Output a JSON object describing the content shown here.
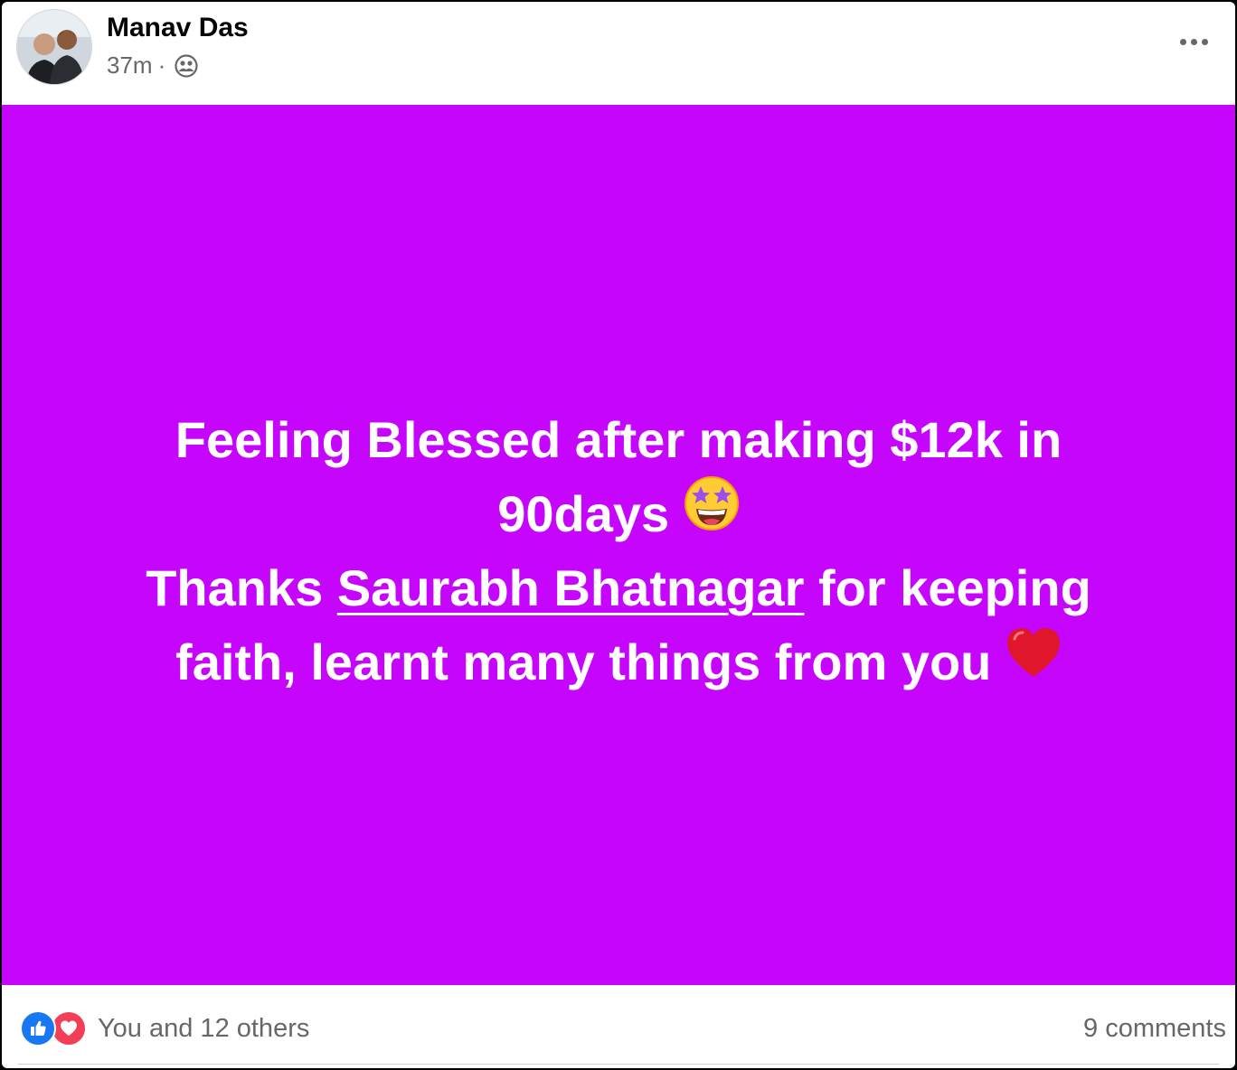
{
  "post": {
    "author": "Manav Das",
    "time": "37m",
    "separator": "·",
    "privacy_icon": "friends-icon",
    "background_color": "#c505fc",
    "text": {
      "line1": "Feeling Blessed after making $12k in",
      "line2": "90days",
      "emoji_star_struck": "star-struck-emoji",
      "line3_prefix": "Thanks ",
      "mention": "Saurabh Bhatnagar",
      "line3_suffix": " for keeping",
      "line4": "faith, learnt many things from you",
      "emoji_heart": "red-heart-emoji"
    }
  },
  "footer": {
    "reactions_text": "You and 12 others",
    "comments": "9 comments",
    "reaction_icons": [
      "like-icon",
      "love-icon"
    ]
  }
}
